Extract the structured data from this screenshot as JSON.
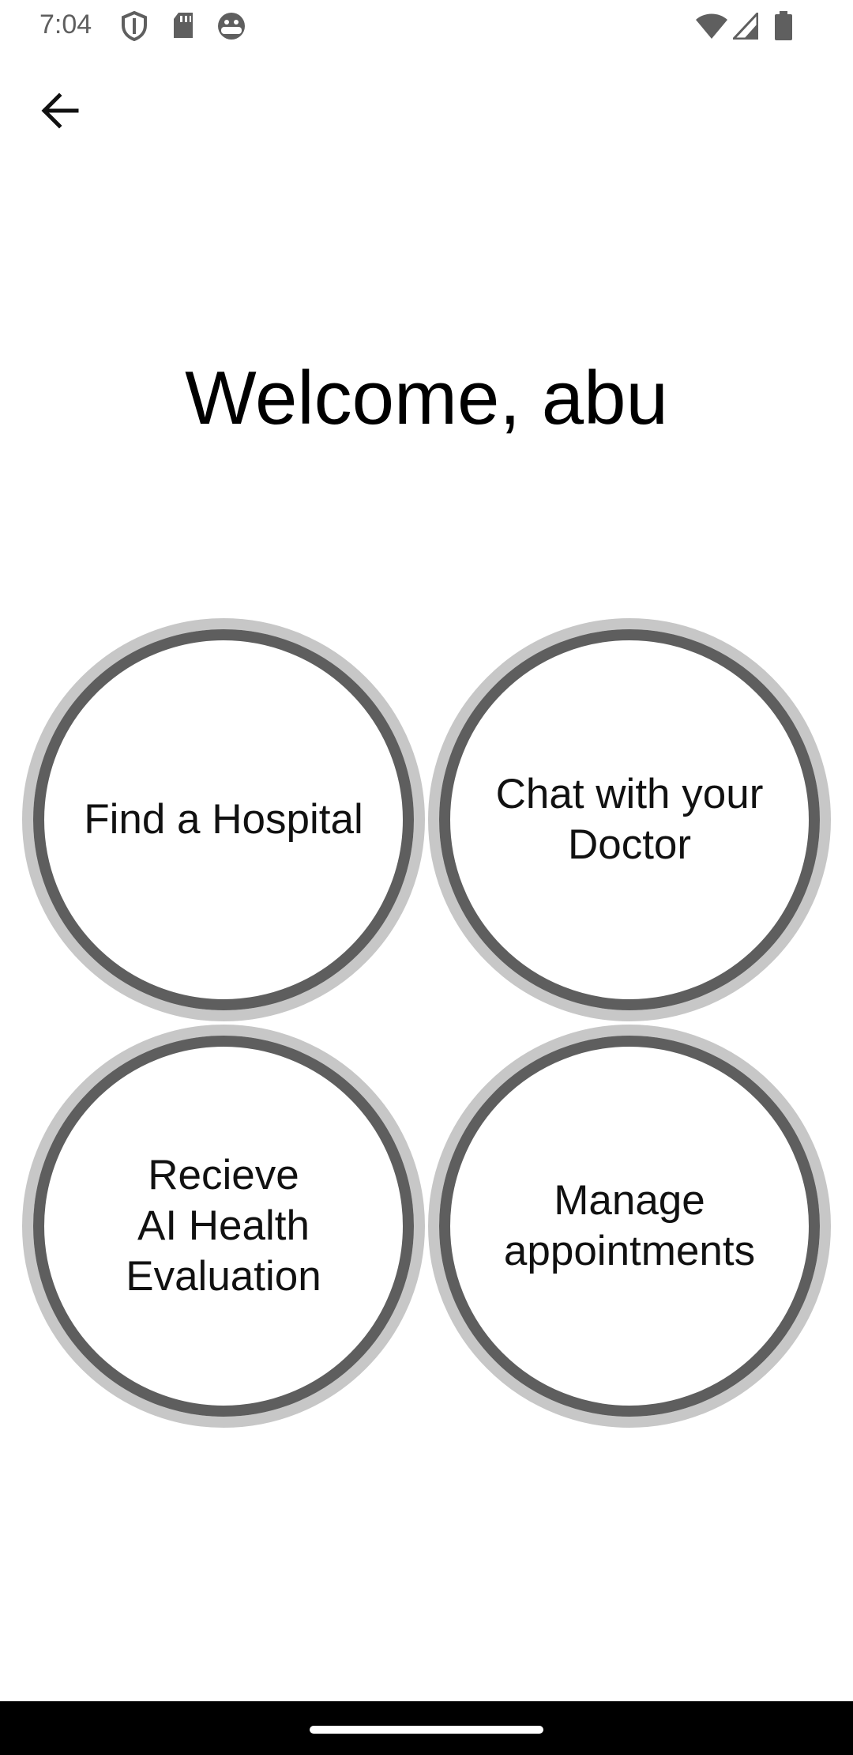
{
  "status_bar": {
    "time": "7:04",
    "left_icons": [
      "shield-icon",
      "sd-card-icon",
      "android-face-icon"
    ],
    "right_icons": [
      "wifi-icon",
      "cellular-signal-icon",
      "battery-icon"
    ]
  },
  "toolbar": {
    "back_icon": "arrow-back-icon"
  },
  "main": {
    "welcome_text": "Welcome, abu",
    "actions": [
      {
        "label": "Find a Hospital"
      },
      {
        "label": "Chat with your\nDoctor"
      },
      {
        "label": "Recieve\nAI Health\nEvaluation"
      },
      {
        "label": "Manage\nappointments"
      }
    ]
  },
  "colors": {
    "background": "#ffffff",
    "ring_outer": "#c7c7c7",
    "ring_inner": "#5e5e5e",
    "text": "#111111",
    "nav_bar": "#000000"
  }
}
